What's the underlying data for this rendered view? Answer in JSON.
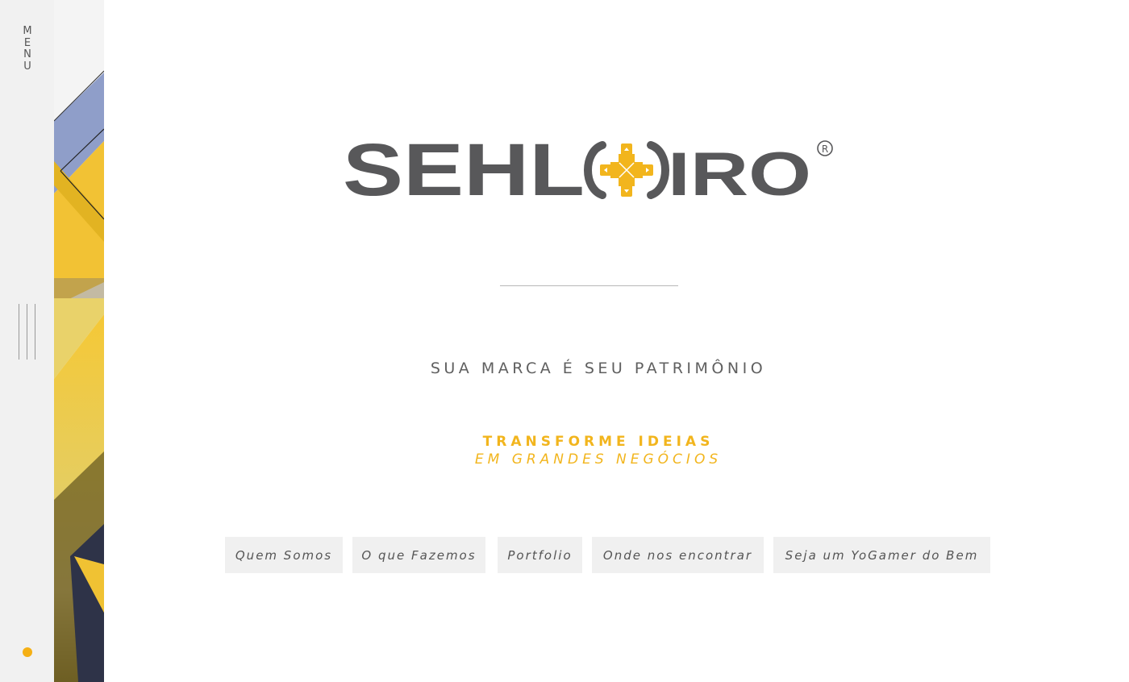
{
  "sidebar": {
    "menu_label": "MENU",
    "accent_color": "#f5b015"
  },
  "brand": {
    "logo_text_left": "SEHL",
    "logo_text_right": "IRO",
    "registered_mark": "®",
    "logo_color": "#58585a",
    "gamepad_color": "#f2b51d"
  },
  "hero": {
    "tagline": "SUA MARCA É SEU PATRIMÔNIO",
    "cta_line1": "TRANSFORME IDEIAS",
    "cta_line2": "EM GRANDES NEGÓCIOS"
  },
  "nav": {
    "items": [
      {
        "label": "Quem Somos"
      },
      {
        "label": "O que Fazemos"
      },
      {
        "label": "Portfolio"
      },
      {
        "label": "Onde nos encontrar"
      },
      {
        "label": "Seja um YoGamer do Bem"
      }
    ]
  }
}
